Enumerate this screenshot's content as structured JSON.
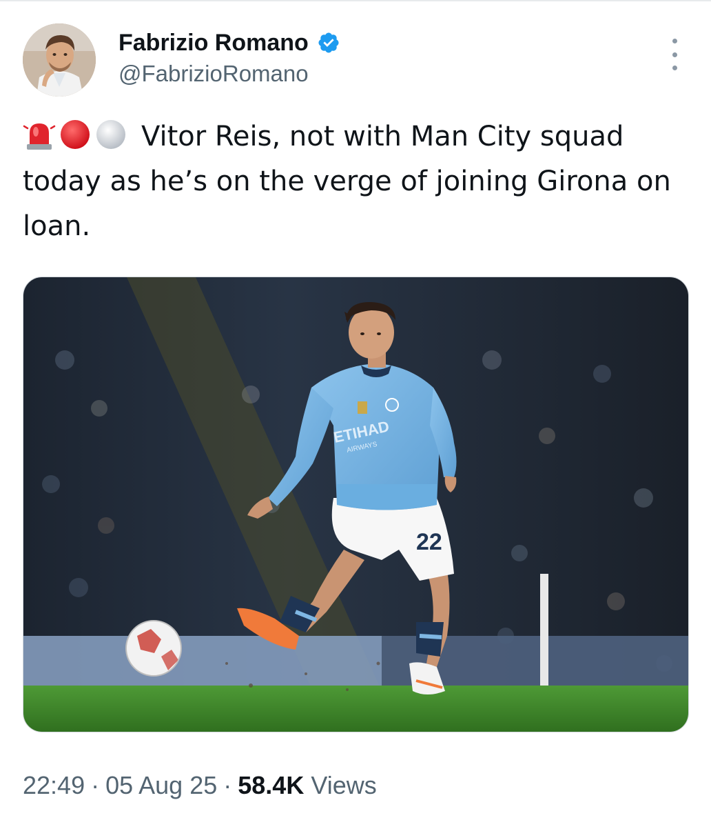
{
  "author": {
    "name": "Fabrizio Romano",
    "handle": "@FabrizioRomano",
    "verified": true,
    "verified_color": "#1d9bf0"
  },
  "tweet": {
    "emojis": [
      "police-car-light",
      "red-circle",
      "white-circle"
    ],
    "text": "Vitor Reis, not with Man City squad today as he’s on the verge of joining Girona on loan."
  },
  "media": {
    "shirt_sponsor": "ETIHAD",
    "shirt_sponsor_sub": "AIRWAYS",
    "shirt_number": "22"
  },
  "footer": {
    "time": "22:49",
    "separator": "·",
    "date": "05 Aug 25",
    "views_count": "58.4K",
    "views_label": "Views"
  },
  "colors": {
    "secondary_text": "#536471",
    "primary_text": "#0f1419",
    "city_blue": "#7fb7e3",
    "pitch_green": "#3f8a2a"
  }
}
